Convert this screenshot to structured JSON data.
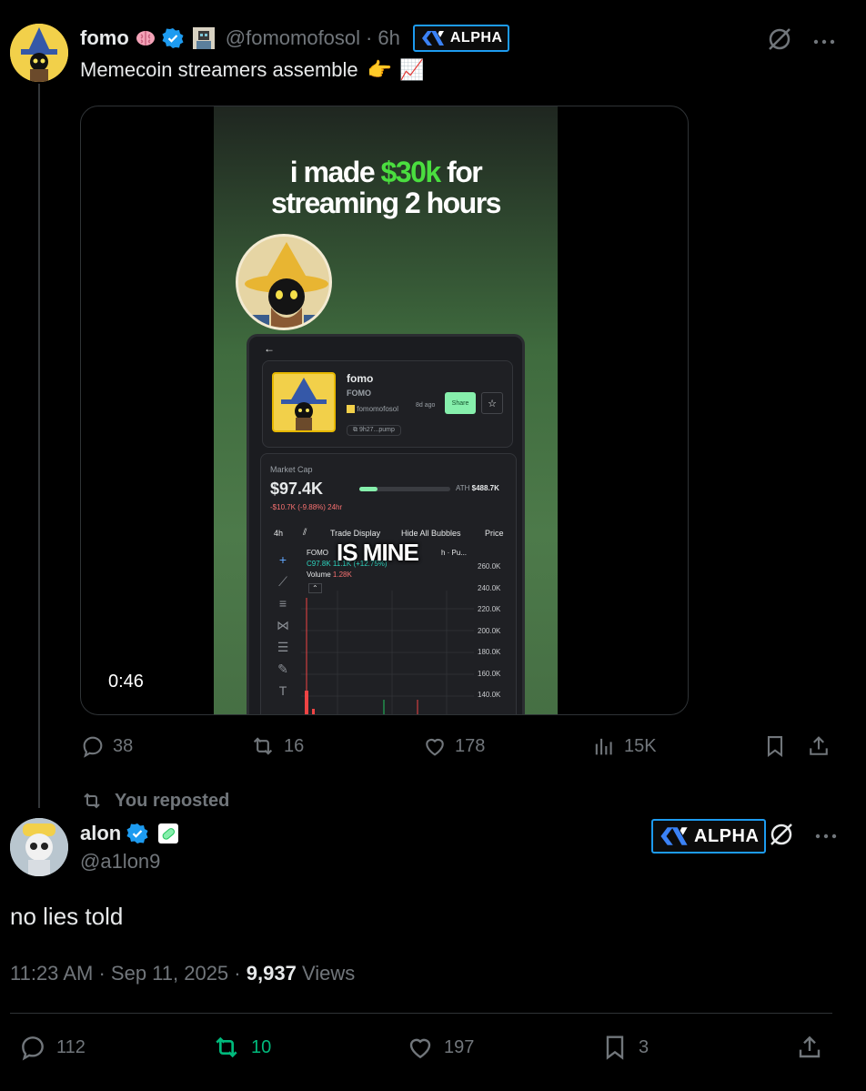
{
  "colors": {
    "background": "#000000",
    "text": "#e7e9ea",
    "muted": "#71767b",
    "accent_blue": "#1d9bf0",
    "repost_green": "#00ba7c"
  },
  "quoted_post": {
    "author": {
      "display_name": "fomo",
      "handle": "@fomomofosol",
      "time": "6h",
      "badge": "ALPHA",
      "emojis": [
        "brain-emoji",
        "verified-badge-icon",
        "pixel-avatar-emoji"
      ]
    },
    "text": "Memecoin streamers assemble",
    "text_emojis": [
      "👉",
      "📈"
    ],
    "video": {
      "headline_part1": "i made ",
      "headline_money": "$30k",
      "headline_part2": " for",
      "headline_line2": "streaming 2 hours",
      "duration": "0:46",
      "caption": "IS MINE",
      "app": {
        "token_name": "fomo",
        "token_ticker": "FOMO",
        "creator": "fomomofosol",
        "age": "8d ago",
        "contract": "9h27...pump",
        "share_label": "Share",
        "market_cap_label": "Market Cap",
        "market_cap_value": "$97.4K",
        "ath_label": "ATH",
        "ath_value": "$488.7K",
        "change": "-$10.7K (-9.88%) 24hr",
        "tabs": [
          "4h",
          "Trade Display",
          "Hide All Bubbles",
          "Price"
        ],
        "ohlc_name": "FOMO",
        "ohlc_mid": "h · Pu...",
        "ohlc_values": "C97.8K 11.1K (+12.75%)",
        "volume_label": "Volume",
        "volume_value": "1.28K",
        "price_ticks": [
          "260.0K",
          "240.0K",
          "220.0K",
          "200.0K",
          "180.0K",
          "160.0K",
          "140.0K"
        ]
      }
    },
    "stats": {
      "replies": "38",
      "reposts": "16",
      "likes": "178",
      "views": "15K"
    }
  },
  "repost_label": "You reposted",
  "main_post": {
    "author": {
      "display_name": "alon",
      "handle": "@a1lon9",
      "badge": "ALPHA"
    },
    "text": "no lies told",
    "time": "11:23 AM",
    "date": "Sep 11, 2025",
    "views_count": "9,937",
    "views_label": "Views",
    "stats": {
      "replies": "112",
      "reposts": "10",
      "likes": "197",
      "bookmarks": "3"
    }
  }
}
